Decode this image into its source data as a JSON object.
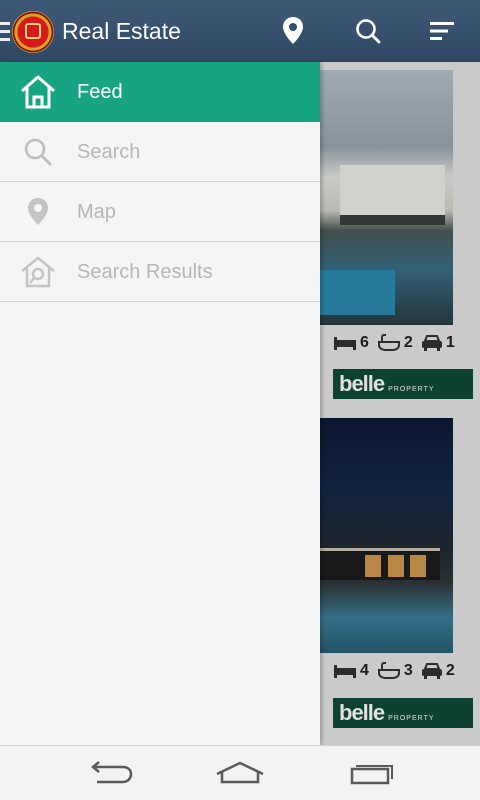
{
  "app": {
    "title": "Real Estate"
  },
  "colors": {
    "appbar": "#2f4763",
    "accent": "#17a482",
    "drawer_bg": "#f5f5f5",
    "drawer_text_inactive": "#b6b6b6"
  },
  "header_actions": [
    {
      "name": "location-pin-icon"
    },
    {
      "name": "search-icon"
    },
    {
      "name": "filter-icon"
    }
  ],
  "drawer": {
    "items": [
      {
        "label": "Feed",
        "icon": "home-icon",
        "active": true
      },
      {
        "label": "Search",
        "icon": "search-icon",
        "active": false
      },
      {
        "label": "Map",
        "icon": "location-pin-icon",
        "active": false
      },
      {
        "label": "Search Results",
        "icon": "search-house-icon",
        "active": false
      }
    ]
  },
  "listings": [
    {
      "beds": "6",
      "baths": "2",
      "cars": "1",
      "agency": "belle",
      "agency_sub": "PROPERTY"
    },
    {
      "beds": "4",
      "baths": "3",
      "cars": "2",
      "agency": "belle",
      "agency_sub": "PROPERTY"
    }
  ],
  "navbar": [
    {
      "name": "back-icon"
    },
    {
      "name": "home-icon"
    },
    {
      "name": "recent-apps-icon"
    }
  ]
}
